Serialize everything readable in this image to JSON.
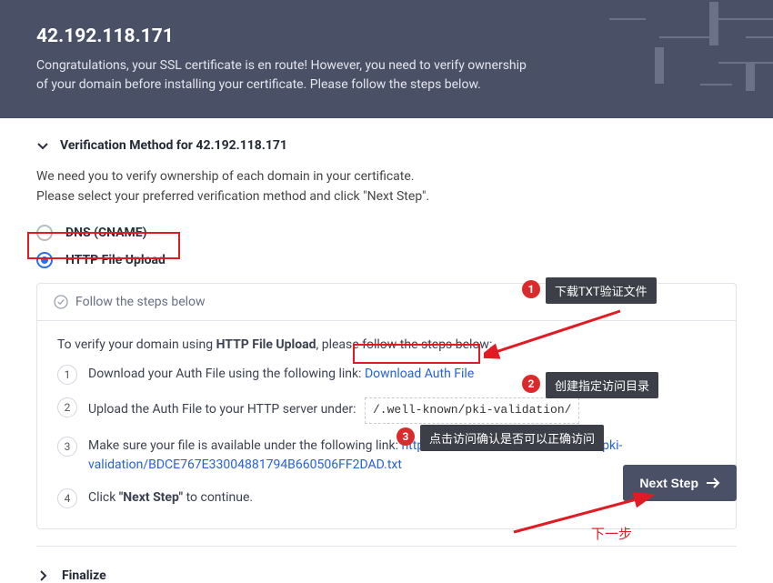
{
  "header": {
    "ip": "42.192.118.171",
    "line1": "Congratulations, your SSL certificate is en route! However, you need to verify ownership",
    "line2": "of your domain before installing your certificate. Please follow the steps below."
  },
  "section": {
    "title": "Verification Method for 42.192.118.171",
    "intro1": "We need you to verify ownership of each domain in your certificate.",
    "intro2": "Please select your preferred verification method and click \"Next Step\"."
  },
  "methods": {
    "dns": "DNS (CNAME)",
    "http": "HTTP File Upload"
  },
  "panel": {
    "head": "Follow the steps below",
    "lead_pre": "To verify your domain using ",
    "lead_bold": "HTTP File Upload",
    "lead_post": ", please follow the steps below:",
    "step1_pre": "Download your Auth File using the following link: ",
    "step1_link": "Download Auth File",
    "step2_pre": "Upload the Auth File to your HTTP server under:",
    "step2_path": "/.well-known/pki-validation/",
    "step3_pre": "Make sure your file is available under the following link: ",
    "step3_link": "http://42.192.118.171/.well-known/pki-validation/BDCE767E33004881794B660506FF2DAD.txt",
    "step4_pre": "Click ",
    "step4_bold": "\"Next Step\"",
    "step4_post": " to continue."
  },
  "buttons": {
    "next": "Next Step"
  },
  "finalize": {
    "label": "Finalize"
  },
  "annotations": {
    "a1": "下载TXT验证文件",
    "a2": "创建指定访问目录",
    "a3": "点击访问确认是否可以正确访问",
    "next_cn": "下一步"
  }
}
